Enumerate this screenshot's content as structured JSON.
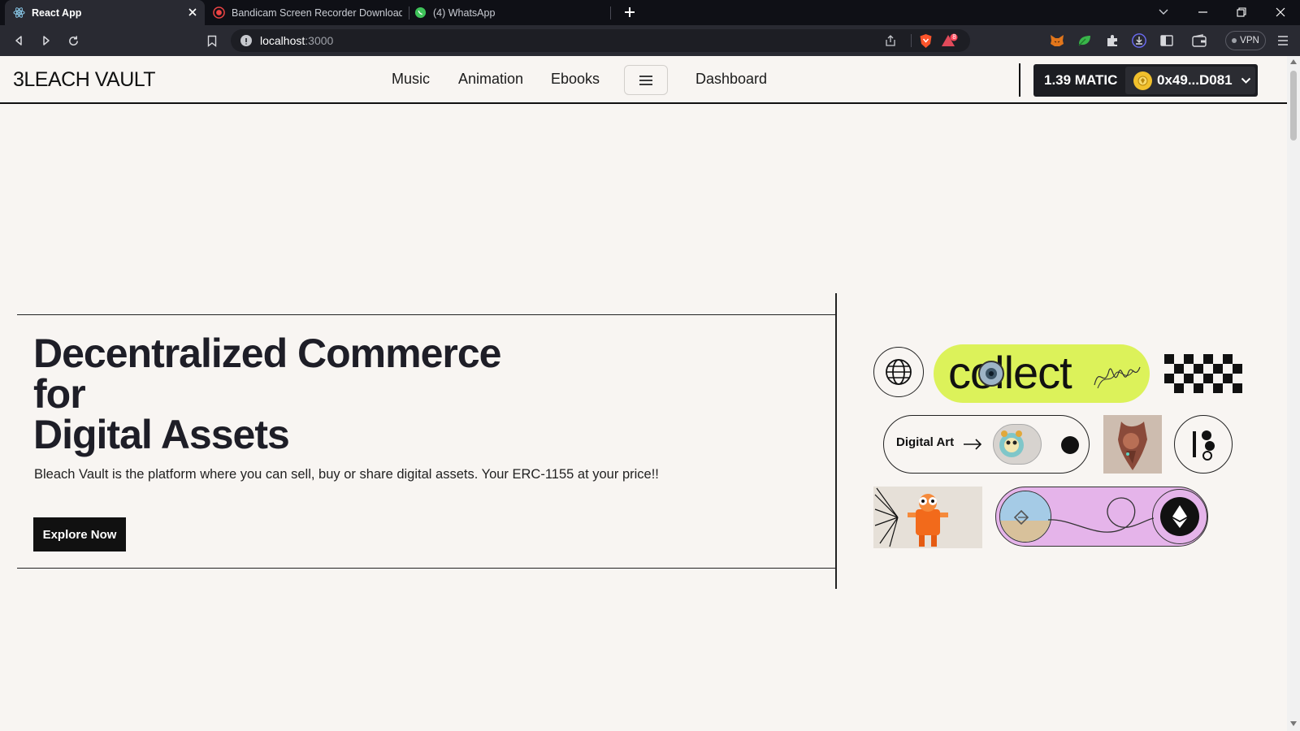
{
  "browser": {
    "tabs": [
      {
        "title": "React App",
        "active": true,
        "icon": "react-icon"
      },
      {
        "title": "Bandicam Screen Recorder Download",
        "active": false,
        "icon": "bandicam-icon"
      },
      {
        "title": "(4) WhatsApp",
        "active": false,
        "icon": "whatsapp-icon"
      }
    ],
    "url": {
      "host": "localhost",
      "port": ":3000"
    },
    "vpn_label": "VPN",
    "shields_badge": "8"
  },
  "site": {
    "logo": "3LEACH VAULT",
    "nav": {
      "music": "Music",
      "animation": "Animation",
      "ebooks": "Ebooks",
      "dashboard": "Dashboard"
    },
    "wallet": {
      "balance": "1.39 MATIC",
      "account": "0x49...D081"
    }
  },
  "hero": {
    "headline_line1": "Decentralized Commerce",
    "headline_line2": "for",
    "headline_line3": "Digital Assets",
    "subtext": "Bleach Vault is the platform where you can sell, buy or share digital assets. Your ERC-1155 at your price!!",
    "cta": "Explore Now"
  },
  "collage": {
    "collect_word": "collect",
    "digital_art_label": "Digital Art",
    "colors": {
      "lime": "#dcf25a",
      "lavender": "#e5b4ea"
    }
  }
}
